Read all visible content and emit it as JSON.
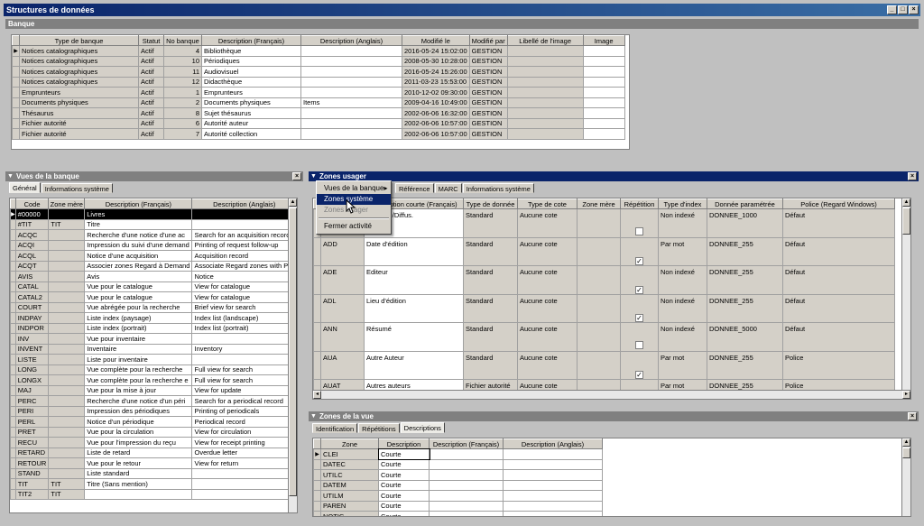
{
  "window": {
    "title": "Structures de données",
    "btn_min": "_",
    "btn_max": "□",
    "btn_close": "×"
  },
  "banque": {
    "section": "Banque",
    "columns": [
      "Type de banque",
      "Statut",
      "No banque",
      "Description (Français)",
      "Description (Anglais)",
      "Modifié le",
      "Modifié par",
      "Libellé de l'image",
      "Image"
    ],
    "rows": [
      [
        "Notices catalographiques",
        "Actif",
        "4",
        "Bibliothèque",
        "",
        "2016-05-24 15:02:00",
        "GESTION",
        "",
        ""
      ],
      [
        "Notices catalographiques",
        "Actif",
        "10",
        "Périodiques",
        "",
        "2008-05-30 10:28:00",
        "GESTION",
        "",
        ""
      ],
      [
        "Notices catalographiques",
        "Actif",
        "11",
        "Audiovisuel",
        "",
        "2016-05-24 15:26:00",
        "GESTION",
        "",
        ""
      ],
      [
        "Notices catalographiques",
        "Actif",
        "12",
        "Didacthèque",
        "",
        "2011-03-23 15:53:00",
        "GESTION",
        "",
        ""
      ],
      [
        "Emprunteurs",
        "Actif",
        "1",
        "Emprunteurs",
        "",
        "2010-12-02 09:30:00",
        "GESTION",
        "",
        ""
      ],
      [
        "Documents physiques",
        "Actif",
        "2",
        "Documents physiques",
        "Items",
        "2009-04-16 10:49:00",
        "GESTION",
        "",
        ""
      ],
      [
        "Thésaurus",
        "Actif",
        "8",
        "Sujet thésaurus",
        "",
        "2002-06-06 16:32:00",
        "GESTION",
        "",
        ""
      ],
      [
        "Fichier autorité",
        "Actif",
        "6",
        "Autorité auteur",
        "",
        "2002-06-06 10:57:00",
        "GESTION",
        "",
        ""
      ],
      [
        "Fichier autorité",
        "Actif",
        "7",
        "Autorité collection",
        "",
        "2002-06-06 10:57:00",
        "GESTION",
        "",
        ""
      ]
    ]
  },
  "vues": {
    "title": "Vues de la banque",
    "tabs": [
      "Général",
      "Informations système"
    ],
    "columns": [
      "Code",
      "Zone mère",
      "Description (Français)",
      "Description (Anglais)"
    ],
    "rows": [
      [
        "#00000",
        "",
        "Livres",
        ""
      ],
      [
        "#TIT",
        "TIT",
        "Titre",
        ""
      ],
      [
        "ACQC",
        "",
        "Recherche d'une notice d'une ac",
        "Search for an acquisition record"
      ],
      [
        "ACQI",
        "",
        "Impression du suivi d'une demand",
        "Printing of request follow-up"
      ],
      [
        "ACQL",
        "",
        "Notice d'une acquisition",
        "Acquisition record"
      ],
      [
        "ACQT",
        "",
        "Associer zones Regard à Demand",
        "Associate Regard zones with Pur"
      ],
      [
        "AVIS",
        "",
        "Avis",
        "Notice"
      ],
      [
        "CATAL",
        "",
        "Vue pour le catalogue",
        "View for catalogue"
      ],
      [
        "CATAL2",
        "",
        "Vue pour le catalogue",
        "View for catalogue"
      ],
      [
        "COURT",
        "",
        "Vue abrégée pour la recherche",
        "Brief view for search"
      ],
      [
        "INDPAY",
        "",
        "Liste index (paysage)",
        "Index list (landscape)"
      ],
      [
        "INDPOR",
        "",
        "Liste index (portrait)",
        "Index list (portrait)"
      ],
      [
        "INV",
        "",
        "Vue pour inventaire",
        ""
      ],
      [
        "INVENT",
        "",
        "Inventaire",
        "Inventory"
      ],
      [
        "LISTE",
        "",
        "Liste pour inventaire",
        ""
      ],
      [
        "LONG",
        "",
        "Vue complète pour la recherche",
        "Full view for search"
      ],
      [
        "LONGX",
        "",
        "Vue complète pour la recherche e",
        "Full view for search"
      ],
      [
        "MAJ",
        "",
        "Vue pour la mise à jour",
        "View for update"
      ],
      [
        "PERC",
        "",
        "Recherche d'une notice d'un péri",
        "Search for a periodical record"
      ],
      [
        "PERI",
        "",
        "Impression des périodiques",
        "Printing of periodicals"
      ],
      [
        "PERL",
        "",
        "Notice d'un périodique",
        "Periodical record"
      ],
      [
        "PRET",
        "",
        "Vue pour la circulation",
        "View for circulation"
      ],
      [
        "RECU",
        "",
        "Vue pour l'impression du reçu",
        "View for receipt printing"
      ],
      [
        "RETARD",
        "",
        "Liste de retard",
        "Overdue letter"
      ],
      [
        "RETOUR",
        "",
        "Vue pour le retour",
        "View for return"
      ],
      [
        "STAND",
        "",
        "Liste standard",
        ""
      ],
      [
        "TIT",
        "TIT",
        "Titre (Sans mention)",
        ""
      ],
      [
        "TIT2",
        "TIT",
        "",
        ""
      ]
    ]
  },
  "zones": {
    "title": "Zones usager",
    "tabs": [
      "Référence",
      "MARC",
      "Informations système"
    ],
    "columns": [
      "",
      "Description courte (Français)",
      "Type de donnée",
      "Type de cote",
      "Zone mère",
      "Répétition",
      "Type d'index",
      "Donnée paramétrée",
      "Police (Regard Windows)"
    ],
    "rows": [
      [
        "",
        "Mention /Diffus.",
        "Standard",
        "Aucune cote",
        "",
        false,
        "Non indexé",
        "DONNEE_1000",
        "Défaut"
      ],
      [
        "ADD",
        "Date d'édition",
        "Standard",
        "Aucune cote",
        "",
        true,
        "Par mot",
        "DONNEE_255",
        "Défaut"
      ],
      [
        "ADE",
        "Editeur",
        "Standard",
        "Aucune cote",
        "",
        true,
        "Non indexé",
        "DONNEE_255",
        "Défaut"
      ],
      [
        "ADL",
        "Lieu d'édition",
        "Standard",
        "Aucune cote",
        "",
        true,
        "Non indexé",
        "DONNEE_255",
        "Défaut"
      ],
      [
        "ANN",
        "Résumé",
        "Standard",
        "Aucune cote",
        "",
        false,
        "Non indexé",
        "DONNEE_5000",
        "Défaut"
      ],
      [
        "AUA",
        "Autre Auteur",
        "Standard",
        "Aucune cote",
        "",
        true,
        "Par mot",
        "DONNEE_255",
        "Police"
      ],
      [
        "AUAT",
        "Autres auteurs",
        "Fichier autorité",
        "Aucune cote",
        "",
        true,
        "Par mot",
        "DONNEE_255",
        "Police"
      ]
    ]
  },
  "menu": {
    "items": [
      "Vues de la banque",
      "Zones système",
      "Zones usager",
      "Fermer activité"
    ],
    "arrow": "▸"
  },
  "zonesvue": {
    "title": "Zones de la vue",
    "tabs": [
      "Identification",
      "Répétitions",
      "Descriptions"
    ],
    "columns": [
      "Zone",
      "Description",
      "Description (Français)",
      "Description (Anglais)"
    ],
    "rows": [
      [
        "CLEI",
        "Courte",
        "",
        ""
      ],
      [
        "DATEC",
        "Courte",
        "",
        ""
      ],
      [
        "UTILC",
        "Courte",
        "",
        ""
      ],
      [
        "DATEM",
        "Courte",
        "",
        ""
      ],
      [
        "UTILM",
        "Courte",
        "",
        ""
      ],
      [
        "PAREN",
        "Courte",
        "",
        ""
      ],
      [
        "NOTIC",
        "Courte",
        "",
        ""
      ]
    ]
  }
}
